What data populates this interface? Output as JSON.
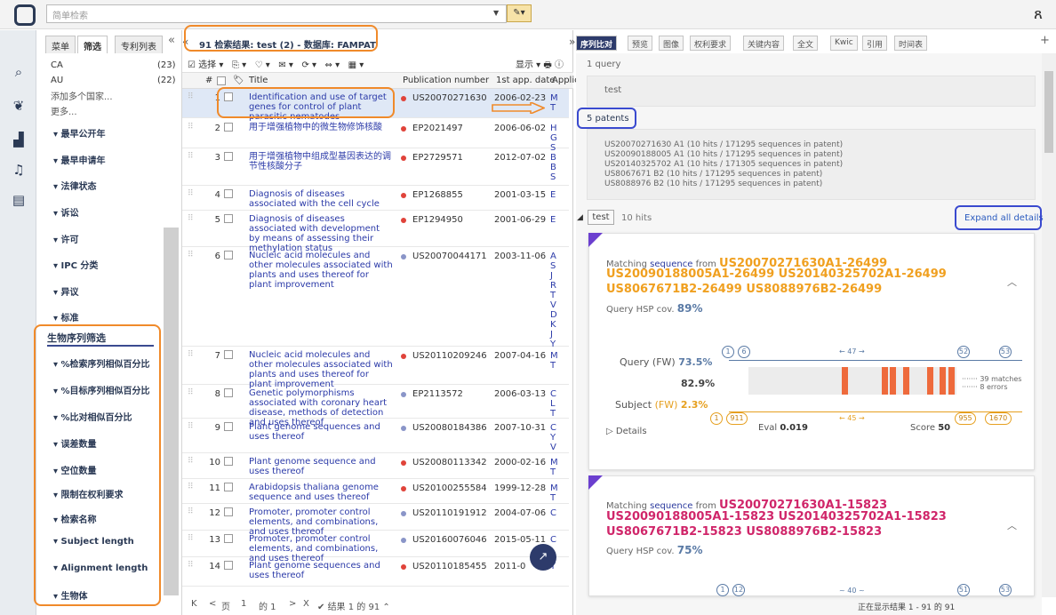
{
  "search": {
    "placeholder": "简单检索"
  },
  "filter_tabs": [
    "菜单",
    "筛选",
    "专利列表"
  ],
  "countries": [
    {
      "name": "CA",
      "count": "(23)"
    },
    {
      "name": "AU",
      "count": "(22)"
    }
  ],
  "filter_links": [
    "添加多个国家...",
    "更多..."
  ],
  "filter_groups": [
    "最早公开年",
    "最早申请年",
    "法律状态",
    "诉讼",
    "许可",
    "IPC 分类",
    "异议",
    "标准"
  ],
  "bio_title": "生物序列筛选",
  "bio_groups": [
    "%检索序列相似百分比",
    "%目标序列相似百分比",
    "%比对相似百分比",
    "误差数量",
    "空位数量",
    "限制在权利要求",
    "检索名称",
    "Subject length",
    "Alignment length",
    "生物体"
  ],
  "results": {
    "title": "91 检索结果:  test (2) - 数据库: FAMPAT",
    "select_label": "选择",
    "display_label": "显示",
    "columns": {
      "num": "#",
      "title": "Title",
      "pub": "Publication number",
      "date": "1st app. date",
      "app": "Applic"
    },
    "rows": [
      {
        "num": "1",
        "title": "Identification and use of target genes for control of plant parasitic nematodes",
        "pub": "US20070271630",
        "date": "2006-02-23",
        "app": "M T",
        "dot": "#e0433a"
      },
      {
        "num": "2",
        "title": "用于增强植物中的微生物修饰核酸",
        "pub": "EP2021497",
        "date": "2006-06-02",
        "app": "H G S",
        "dot": "#e0433a"
      },
      {
        "num": "3",
        "title": "用于增强植物中组成型基因表达的调节性核酸分子",
        "pub": "EP2729571",
        "date": "2012-07-02",
        "app": "B B S",
        "dot": "#e0433a"
      },
      {
        "num": "4",
        "title": "Diagnosis of diseases associated with the cell cycle",
        "pub": "EP1268855",
        "date": "2001-03-15",
        "app": "E",
        "dot": "#e0433a"
      },
      {
        "num": "5",
        "title": "Diagnosis of diseases associated with development by means of assessing their methylation status",
        "pub": "EP1294950",
        "date": "2001-06-29",
        "app": "E",
        "dot": "#e0433a"
      },
      {
        "num": "6",
        "title": "Nucleic acid molecules and other molecules associated with plants and uses thereof for plant improvement",
        "pub": "US20070044171",
        "date": "2003-11-06",
        "app": "A S J R T V D K J Y",
        "dot": "#8a95c8"
      },
      {
        "num": "7",
        "title": "Nucleic acid molecules and other molecules associated with plants and uses thereof for plant improvement",
        "pub": "US20110209246",
        "date": "2007-04-16",
        "app": "M T",
        "dot": "#e0433a"
      },
      {
        "num": "8",
        "title": "Genetic polymorphisms associated with coronary heart disease, methods of detection and uses thereof",
        "pub": "EP2113572",
        "date": "2006-03-13",
        "app": "C L T",
        "dot": "#8a95c8"
      },
      {
        "num": "9",
        "title": "Plant genome sequences and uses thereof",
        "pub": "US20080184386",
        "date": "2007-10-31",
        "app": "C Y V",
        "dot": "#8a95c8"
      },
      {
        "num": "10",
        "title": "Plant genome sequence and uses thereof",
        "pub": "US20080113342",
        "date": "2000-02-16",
        "app": "M T",
        "dot": "#e0433a"
      },
      {
        "num": "11",
        "title": "Arabidopsis thaliana genome sequence and uses thereof",
        "pub": "US20100255584",
        "date": "1999-12-28",
        "app": "M T",
        "dot": "#e0433a"
      },
      {
        "num": "12",
        "title": "Promoter, promoter control elements, and combinations, and uses thereof",
        "pub": "US20110191912",
        "date": "2004-07-06",
        "app": "C",
        "dot": "#8a95c8"
      },
      {
        "num": "13",
        "title": "Promoter, promoter control elements, and combinations, and uses thereof",
        "pub": "US20160076046",
        "date": "2015-05-11",
        "app": "C",
        "dot": "#8a95c8"
      },
      {
        "num": "14",
        "title": "Plant genome sequences and uses thereof",
        "pub": "US20110185455",
        "date": "2011-0",
        "app": "Y",
        "dot": "#e0433a"
      }
    ],
    "pager": {
      "first": "K",
      "prev": "<",
      "page_label": "页",
      "page": "1",
      "of": "的 1",
      "next": ">",
      "last": "X",
      "result_text": "结果 1 的 91"
    }
  },
  "right_tabs": [
    "序列比对",
    "预览",
    "图像",
    "权利要求",
    "关键内容",
    "全文",
    "Kwic",
    "引用",
    "时间表"
  ],
  "query_count": "1 query",
  "query_text": "test",
  "patents_count": "5 patents",
  "patents": [
    "US20070271630 A1 (10 hits / 171295 sequences in patent)",
    "US20090188005 A1 (10 hits / 171295 sequences in patent)",
    "US20140325702 A1 (10 hits / 171305 sequences in patent)",
    "US8067671 B2 (10 hits / 171295 sequences in patent)",
    "US8088976 B2 (10 hits / 171295 sequences in patent)"
  ],
  "hits": {
    "query": "test",
    "count": "10 hits",
    "expand_label": "Expand all details"
  },
  "cards": [
    {
      "matching": "Matching",
      "sequence": "sequence",
      "from": "from",
      "primary": "US20070271630A1-26499",
      "others": [
        "US20090188005A1-26499 US20140325702A1-26499",
        "US8067671B2-26499 US8088976B2-26499"
      ],
      "hsp_label": "Query HSP cov.",
      "hsp_value": "89%",
      "color": "#f0a020"
    },
    {
      "matching": "Matching",
      "sequence": "sequence",
      "from": "from",
      "primary": "US20070271630A1-15823",
      "others": [
        "US20090188005A1-15823 US20140325702A1-15823",
        "US8067671B2-15823 US8088976B2-15823"
      ],
      "hsp_label": "Query HSP cov.",
      "hsp_value": "75%",
      "color": "#d0266a"
    }
  ],
  "alignment": {
    "query_label": "Query (FW)",
    "query_pct": "73.5%",
    "identity_pct": "82.9%",
    "subject_label": "Subject",
    "subject_fw": "(FW)",
    "subject_pct": "2.3%",
    "q_start": "1",
    "q_hsp_start": "6",
    "q_hsp_end": "52",
    "q_end": "53",
    "q_len": "← 47 →",
    "s_start": "1",
    "s_hsp_start": "911",
    "s_hsp_end": "955",
    "s_end": "1670",
    "s_len": "← 45 →",
    "matches": "39 matches",
    "errors": "8 errors",
    "eval_label": "Eval",
    "eval": "0.019",
    "score_label": "Score",
    "score": "50",
    "details": "▷ Details",
    "mismatch_positions": [
      0.45,
      0.64,
      0.68,
      0.745,
      0.86,
      0.92,
      0.96
    ]
  },
  "card2_circles": [
    "1",
    "12",
    "~ 40 ~",
    "51",
    "53"
  ],
  "status": "正在显示结果 1 - 91 的 91"
}
